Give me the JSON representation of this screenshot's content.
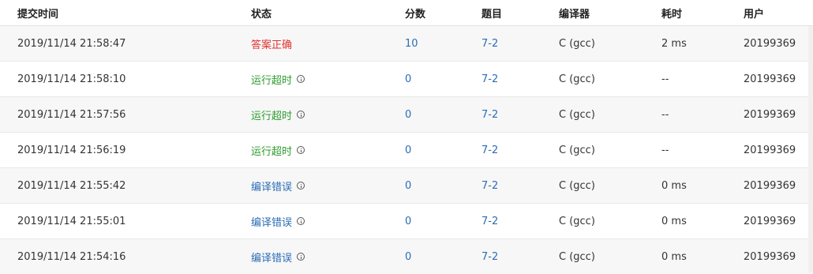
{
  "columns": {
    "time": "提交时间",
    "status": "状态",
    "score": "分数",
    "problem": "题目",
    "compiler": "编译器",
    "cost": "耗时",
    "user": "用户"
  },
  "status_colors": {
    "答案正确": "#e0312f",
    "运行超时": "#2e9b2e",
    "编译错误": "#2a6db5"
  },
  "rows": [
    {
      "time": "2019/11/14 21:58:47",
      "status": "答案正确",
      "score": "10",
      "problem": "7-2",
      "compiler": "C (gcc)",
      "cost": "2 ms",
      "user": "20199369"
    },
    {
      "time": "2019/11/14 21:58:10",
      "status": "运行超时",
      "score": "0",
      "problem": "7-2",
      "compiler": "C (gcc)",
      "cost": "--",
      "user": "20199369"
    },
    {
      "time": "2019/11/14 21:57:56",
      "status": "运行超时",
      "score": "0",
      "problem": "7-2",
      "compiler": "C (gcc)",
      "cost": "--",
      "user": "20199369"
    },
    {
      "time": "2019/11/14 21:56:19",
      "status": "运行超时",
      "score": "0",
      "problem": "7-2",
      "compiler": "C (gcc)",
      "cost": "--",
      "user": "20199369"
    },
    {
      "time": "2019/11/14 21:55:42",
      "status": "编译错误",
      "score": "0",
      "problem": "7-2",
      "compiler": "C (gcc)",
      "cost": "0 ms",
      "user": "20199369"
    },
    {
      "time": "2019/11/14 21:55:01",
      "status": "编译错误",
      "score": "0",
      "problem": "7-2",
      "compiler": "C (gcc)",
      "cost": "0 ms",
      "user": "20199369"
    },
    {
      "time": "2019/11/14 21:54:16",
      "status": "编译错误",
      "score": "0",
      "problem": "7-2",
      "compiler": "C (gcc)",
      "cost": "0 ms",
      "user": "20199369"
    }
  ]
}
